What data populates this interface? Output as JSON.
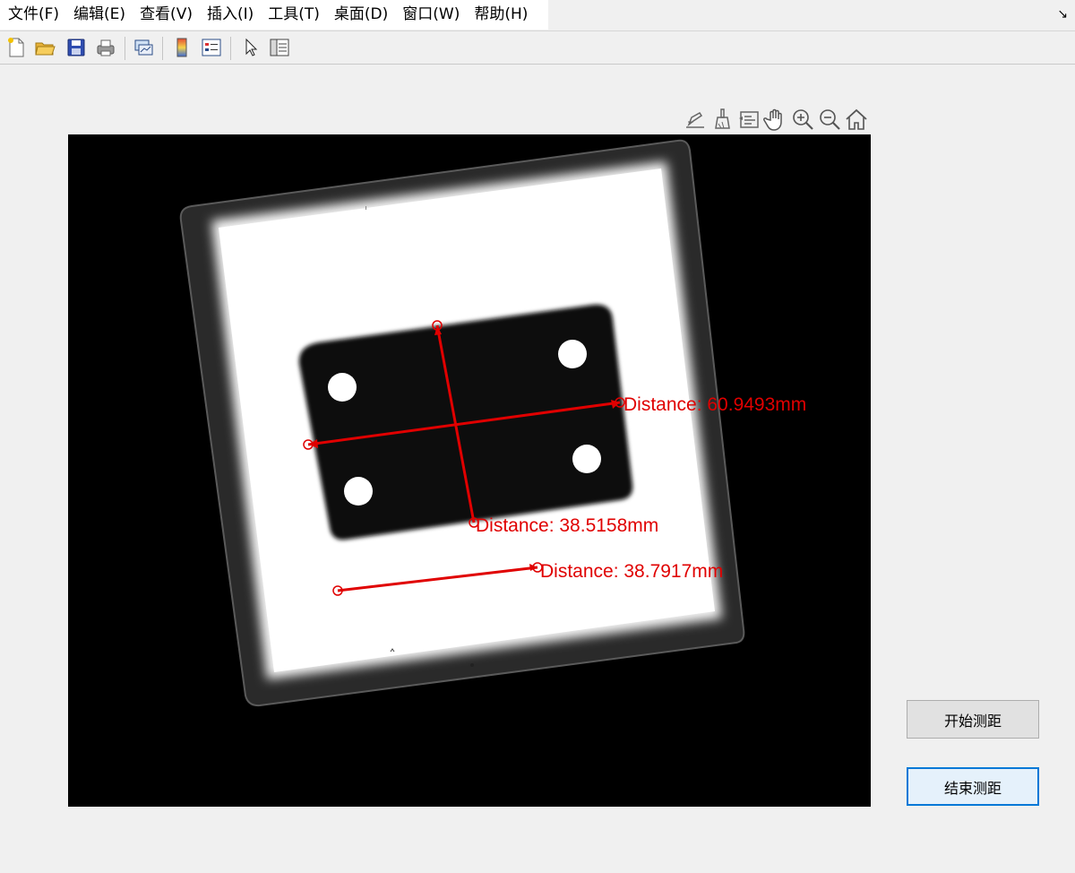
{
  "menu": {
    "items": [
      "文件(F)",
      "编辑(E)",
      "查看(V)",
      "插入(I)",
      "工具(T)",
      "桌面(D)",
      "窗口(W)",
      "帮助(H)"
    ],
    "undock_glyph": "↘"
  },
  "toolbar": {
    "icons": [
      "new-file-icon",
      "open-folder-icon",
      "save-icon",
      "print-icon",
      "link-plot-icon",
      "colorbar-icon",
      "legend-icon",
      "pointer-icon",
      "property-inspector-icon"
    ]
  },
  "axes_toolbar": {
    "icons": [
      "edit-plot-icon",
      "brush-icon",
      "data-tips-icon",
      "pan-hand-icon",
      "zoom-in-icon",
      "zoom-out-icon",
      "home-icon"
    ]
  },
  "measurements": [
    {
      "label": "Distance: 60.9493mm"
    },
    {
      "label": "Distance: 38.5158mm"
    },
    {
      "label": "Distance: 38.7917mm"
    }
  ],
  "buttons": {
    "start_label": "开始测距",
    "end_label": "结束测距"
  },
  "colors": {
    "annotation": "#e00000",
    "focus_border": "#0078d7"
  }
}
